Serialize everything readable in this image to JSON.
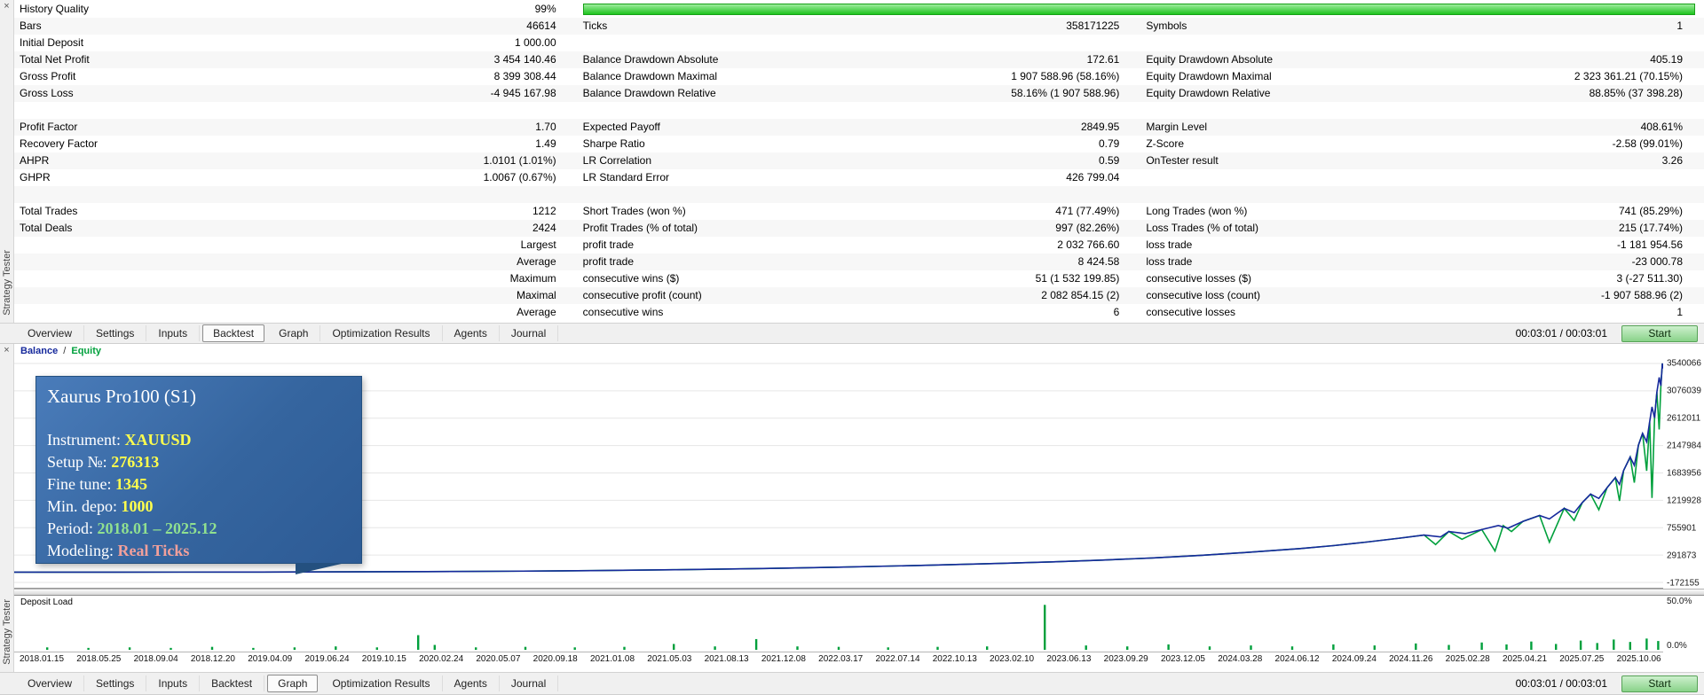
{
  "side_panel": {
    "title": "Strategy Tester",
    "close_glyph": "×"
  },
  "tabs": {
    "items": [
      "Overview",
      "Settings",
      "Inputs",
      "Backtest",
      "Graph",
      "Optimization Results",
      "Agents",
      "Journal"
    ],
    "top_active": "Backtest",
    "bottom_active": "Graph",
    "time": "00:03:01 / 00:03:01",
    "start_label": "Start"
  },
  "stats": {
    "history_label": "History Quality",
    "history_value": "99%",
    "history_bar_color": "#1ec41e",
    "rows": [
      [
        "Bars",
        "46614",
        "Ticks",
        "358171225",
        "Symbols",
        "1"
      ],
      [
        "Initial Deposit",
        "1 000.00",
        "",
        "",
        "",
        ""
      ],
      [
        "Total Net Profit",
        "3 454 140.46",
        "Balance Drawdown Absolute",
        "172.61",
        "Equity Drawdown Absolute",
        "405.19"
      ],
      [
        "Gross Profit",
        "8 399 308.44",
        "Balance Drawdown Maximal",
        "1 907 588.96 (58.16%)",
        "Equity Drawdown Maximal",
        "2 323 361.21 (70.15%)"
      ],
      [
        "Gross Loss",
        "-4 945 167.98",
        "Balance Drawdown Relative",
        "58.16% (1 907 588.96)",
        "Equity Drawdown Relative",
        "88.85% (37 398.28)"
      ],
      [],
      [
        "Profit Factor",
        "1.70",
        "Expected Payoff",
        "2849.95",
        "Margin Level",
        "408.61%"
      ],
      [
        "Recovery Factor",
        "1.49",
        "Sharpe Ratio",
        "0.79",
        "Z-Score",
        "-2.58 (99.01%)"
      ],
      [
        "AHPR",
        "1.0101 (1.01%)",
        "LR Correlation",
        "0.59",
        "OnTester result",
        "3.26"
      ],
      [
        "GHPR",
        "1.0067 (0.67%)",
        "LR Standard Error",
        "426 799.04",
        "",
        ""
      ],
      [],
      [
        "Total Trades",
        "1212",
        "Short Trades (won %)",
        "471 (77.49%)",
        "Long Trades (won %)",
        "741 (85.29%)"
      ],
      [
        "Total Deals",
        "2424",
        "Profit Trades (% of total)",
        "997 (82.26%)",
        "Loss Trades (% of total)",
        "215 (17.74%)"
      ],
      [
        "",
        "Largest",
        "profit trade",
        "2 032 766.60",
        "loss trade",
        "-1 181 954.56"
      ],
      [
        "",
        "Average",
        "profit trade",
        "8 424.58",
        "loss trade",
        "-23 000.78"
      ],
      [
        "",
        "Maximum",
        "consecutive wins ($)",
        "51 (1 532 199.85)",
        "consecutive losses ($)",
        "3 (-27 511.30)"
      ],
      [
        "",
        "Maximal",
        "consecutive profit (count)",
        "2 082 854.15 (2)",
        "consecutive loss (count)",
        "-1 907 588.96 (2)"
      ],
      [
        "",
        "Average",
        "consecutive wins",
        "6",
        "consecutive losses",
        "1"
      ]
    ]
  },
  "info_box": {
    "title": "Xaurus Pro100 (S1)",
    "lines": [
      {
        "label": "Instrument: ",
        "value": "XAUUSD",
        "color": "#ffff4d"
      },
      {
        "label": "Setup №: ",
        "value": "276313",
        "color": "#ffff4d"
      },
      {
        "label": "Fine tune: ",
        "value": "1345",
        "color": "#ffff4d"
      },
      {
        "label": "Min. depo: ",
        "value": "1000",
        "color": "#ffff4d"
      },
      {
        "label": "Period: ",
        "value": "2018.01 – 2025.12",
        "color": "#90e090"
      },
      {
        "label": "Modeling: ",
        "value": "Real Ticks",
        "color": "#f2a09b"
      }
    ]
  },
  "chart_data": {
    "type": "line",
    "title": "Backtest balance and equity curve",
    "legend": [
      {
        "name": "Balance",
        "color": "#16299c"
      },
      {
        "name": "Equity",
        "color": "#00a03c"
      }
    ],
    "legend_separator": "/",
    "ylim": [
      -172155,
      3540066
    ],
    "y_ticks": [
      3540066,
      3076039,
      2612011,
      2147984,
      1683956,
      1219928,
      755901,
      291873,
      -172155
    ],
    "x_ticks": [
      "2018.01.15",
      "2018.05.25",
      "2018.09.04",
      "2018.12.20",
      "2019.04.09",
      "2019.06.24",
      "2019.10.15",
      "2020.02.24",
      "2020.05.07",
      "2020.09.18",
      "2021.01.08",
      "2021.05.03",
      "2021.08.13",
      "2021.12.08",
      "2022.03.17",
      "2022.07.14",
      "2022.10.13",
      "2023.02.10",
      "2023.06.13",
      "2023.09.29",
      "2023.12.05",
      "2024.03.28",
      "2024.06.12",
      "2024.09.24",
      "2024.11.26",
      "2025.02.28",
      "2025.04.21",
      "2025.07.25",
      "2025.10.06"
    ],
    "grid": true,
    "series": [
      {
        "name": "Equity",
        "color": "#00a03c",
        "points": [
          [
            0.0,
            1000
          ],
          [
            0.05,
            1700
          ],
          [
            0.1,
            2700
          ],
          [
            0.15,
            4300
          ],
          [
            0.2,
            7000
          ],
          [
            0.25,
            11500
          ],
          [
            0.3,
            18500
          ],
          [
            0.35,
            29000
          ],
          [
            0.4,
            43000
          ],
          [
            0.45,
            62000
          ],
          [
            0.5,
            87000
          ],
          [
            0.55,
            117000
          ],
          [
            0.6,
            152000
          ],
          [
            0.63,
            176000
          ],
          [
            0.66,
            206000
          ],
          [
            0.69,
            242000
          ],
          [
            0.72,
            287000
          ],
          [
            0.75,
            342000
          ],
          [
            0.78,
            402000
          ],
          [
            0.8,
            452000
          ],
          [
            0.82,
            512000
          ],
          [
            0.84,
            578000
          ],
          [
            0.855,
            632000
          ],
          [
            0.862,
            470000
          ],
          [
            0.87,
            692000
          ],
          [
            0.878,
            560000
          ],
          [
            0.89,
            724000
          ],
          [
            0.898,
            360000
          ],
          [
            0.903,
            792000
          ],
          [
            0.908,
            690000
          ],
          [
            0.915,
            864000
          ],
          [
            0.925,
            962000
          ],
          [
            0.931,
            510000
          ],
          [
            0.94,
            1084000
          ],
          [
            0.946,
            880000
          ],
          [
            0.951,
            1184000
          ],
          [
            0.956,
            1324000
          ],
          [
            0.961,
            1060000
          ],
          [
            0.966,
            1434000
          ],
          [
            0.971,
            1604000
          ],
          [
            0.9735,
            1210000
          ],
          [
            0.976,
            1724000
          ],
          [
            0.98,
            1954000
          ],
          [
            0.9825,
            1520000
          ],
          [
            0.985,
            2154000
          ],
          [
            0.9875,
            2354000
          ],
          [
            0.99,
            1720000
          ],
          [
            0.9918,
            2554000
          ],
          [
            0.9932,
            1260000
          ],
          [
            0.9948,
            2616000
          ],
          [
            0.9962,
            3054000
          ],
          [
            0.9976,
            2420000
          ],
          [
            0.9986,
            3160000
          ],
          [
            0.9995,
            3540066
          ],
          [
            1.0,
            3454140
          ]
        ]
      },
      {
        "name": "Balance",
        "color": "#16299c",
        "points": [
          [
            0.0,
            1000
          ],
          [
            0.05,
            1700
          ],
          [
            0.1,
            2700
          ],
          [
            0.15,
            4300
          ],
          [
            0.2,
            7000
          ],
          [
            0.25,
            11500
          ],
          [
            0.3,
            18500
          ],
          [
            0.35,
            29000
          ],
          [
            0.4,
            43000
          ],
          [
            0.45,
            62000
          ],
          [
            0.5,
            87000
          ],
          [
            0.55,
            117000
          ],
          [
            0.6,
            152000
          ],
          [
            0.63,
            176000
          ],
          [
            0.66,
            206000
          ],
          [
            0.69,
            242000
          ],
          [
            0.72,
            287000
          ],
          [
            0.75,
            342000
          ],
          [
            0.78,
            402000
          ],
          [
            0.8,
            452000
          ],
          [
            0.82,
            512000
          ],
          [
            0.84,
            578000
          ],
          [
            0.855,
            632000
          ],
          [
            0.865,
            600000
          ],
          [
            0.87,
            692000
          ],
          [
            0.88,
            655000
          ],
          [
            0.89,
            724000
          ],
          [
            0.9,
            792000
          ],
          [
            0.906,
            748000
          ],
          [
            0.915,
            864000
          ],
          [
            0.925,
            962000
          ],
          [
            0.931,
            904000
          ],
          [
            0.94,
            1084000
          ],
          [
            0.946,
            1010000
          ],
          [
            0.951,
            1184000
          ],
          [
            0.956,
            1324000
          ],
          [
            0.961,
            1252000
          ],
          [
            0.966,
            1434000
          ],
          [
            0.971,
            1604000
          ],
          [
            0.9735,
            1490000
          ],
          [
            0.976,
            1724000
          ],
          [
            0.98,
            1954000
          ],
          [
            0.9825,
            1812000
          ],
          [
            0.985,
            2154000
          ],
          [
            0.9875,
            2354000
          ],
          [
            0.99,
            2212000
          ],
          [
            0.9918,
            2554000
          ],
          [
            0.9932,
            2804000
          ],
          [
            0.9948,
            2616000
          ],
          [
            0.9962,
            3054000
          ],
          [
            0.9976,
            3304000
          ],
          [
            0.9986,
            3160000
          ],
          [
            0.9995,
            3540066
          ],
          [
            1.0,
            3454140
          ]
        ]
      }
    ],
    "deposit_load": {
      "label": "Deposit Load",
      "scale_top": "50.0%",
      "scale_bottom": "0.0%",
      "color": "#00a03c",
      "bars": [
        [
          0.02,
          0.05
        ],
        [
          0.045,
          0.04
        ],
        [
          0.07,
          0.05
        ],
        [
          0.095,
          0.04
        ],
        [
          0.12,
          0.06
        ],
        [
          0.145,
          0.04
        ],
        [
          0.17,
          0.05
        ],
        [
          0.195,
          0.07
        ],
        [
          0.22,
          0.05
        ],
        [
          0.245,
          0.3
        ],
        [
          0.255,
          0.1
        ],
        [
          0.28,
          0.05
        ],
        [
          0.31,
          0.06
        ],
        [
          0.34,
          0.05
        ],
        [
          0.37,
          0.06
        ],
        [
          0.4,
          0.12
        ],
        [
          0.425,
          0.07
        ],
        [
          0.45,
          0.22
        ],
        [
          0.475,
          0.07
        ],
        [
          0.5,
          0.06
        ],
        [
          0.53,
          0.05
        ],
        [
          0.56,
          0.06
        ],
        [
          0.59,
          0.07
        ],
        [
          0.625,
          0.92
        ],
        [
          0.65,
          0.09
        ],
        [
          0.675,
          0.07
        ],
        [
          0.7,
          0.11
        ],
        [
          0.725,
          0.07
        ],
        [
          0.75,
          0.09
        ],
        [
          0.775,
          0.07
        ],
        [
          0.8,
          0.11
        ],
        [
          0.825,
          0.09
        ],
        [
          0.85,
          0.13
        ],
        [
          0.87,
          0.1
        ],
        [
          0.89,
          0.15
        ],
        [
          0.905,
          0.11
        ],
        [
          0.92,
          0.17
        ],
        [
          0.935,
          0.12
        ],
        [
          0.95,
          0.19
        ],
        [
          0.96,
          0.14
        ],
        [
          0.97,
          0.21
        ],
        [
          0.98,
          0.16
        ],
        [
          0.99,
          0.23
        ],
        [
          0.997,
          0.18
        ]
      ]
    }
  }
}
